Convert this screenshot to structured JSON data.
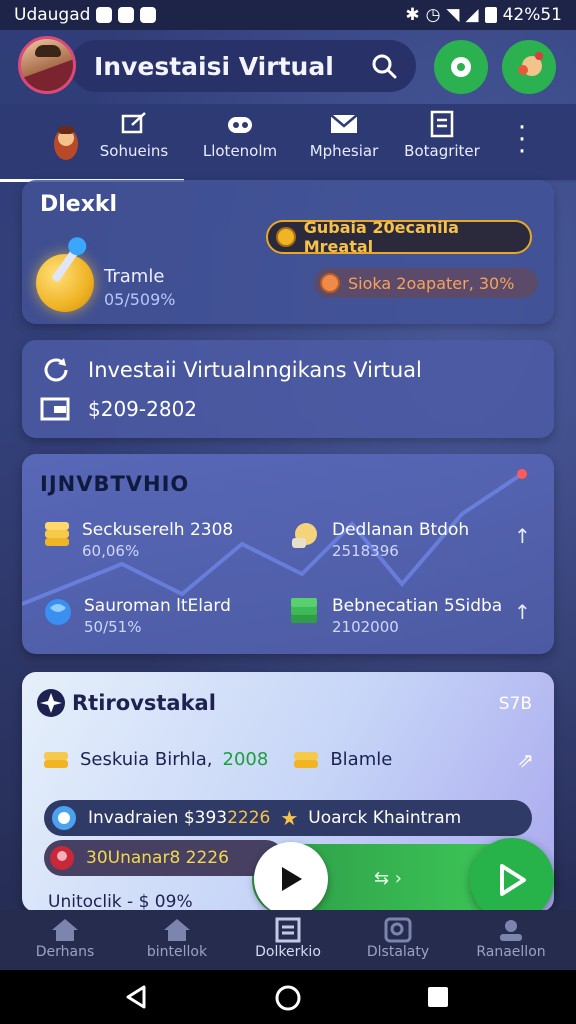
{
  "status_bar": {
    "carrier": "Udaugad",
    "battery_text": "42%51"
  },
  "header": {
    "title": "Investaisi Virtual"
  },
  "tabs": [
    {
      "label": "Sohueins",
      "icon": "edit-icon"
    },
    {
      "label": "Llotenolm",
      "icon": "gamepad-icon"
    },
    {
      "label": "Mphesiar",
      "icon": "mail-icon"
    },
    {
      "label": "Botagriter",
      "icon": "document-icon"
    }
  ],
  "card1": {
    "title": "Dlexkl",
    "item_name": "Tramle",
    "item_pct": "05/509%",
    "badge1": "Gubaia 20ecanila Mreatal",
    "badge2": "Sioka 2oapater, 30%"
  },
  "card2": {
    "line1": "Investaii Virtualnngikans Virtual",
    "line2": "$209-2802"
  },
  "card3": {
    "title": "IJNVBTVHIO",
    "assets": [
      {
        "name": "Seckuserelh 2308",
        "value": "60,06%"
      },
      {
        "name": "Dedlanan Btdoh",
        "value": "2518396"
      },
      {
        "name": "Sauroman ltElard",
        "value": "50/51%"
      },
      {
        "name": "Bebnecatian 5Sidba",
        "value": "2102000"
      }
    ]
  },
  "card4": {
    "title": "Rtirovstakal",
    "value": "S7B",
    "row_text": "Seskuia Birhla,",
    "row_year": "2008",
    "row_right": "Blamle",
    "chip1_left": "Invadraien $393",
    "chip1_highlight": "2226",
    "chip1_right": "Uoarck Khaintram",
    "chip2": "30Unanar8 2226",
    "partial_text": "Unitoclik - $ 09%"
  },
  "bottom_nav": [
    {
      "label": "Derhans",
      "icon": "home-icon"
    },
    {
      "label": "bintellok",
      "icon": "home-icon"
    },
    {
      "label": "Dolkerkio",
      "icon": "calendar-icon"
    },
    {
      "label": "Dlstalaty",
      "icon": "search-icon"
    },
    {
      "label": "Ranaellon",
      "icon": "user-icon"
    }
  ]
}
